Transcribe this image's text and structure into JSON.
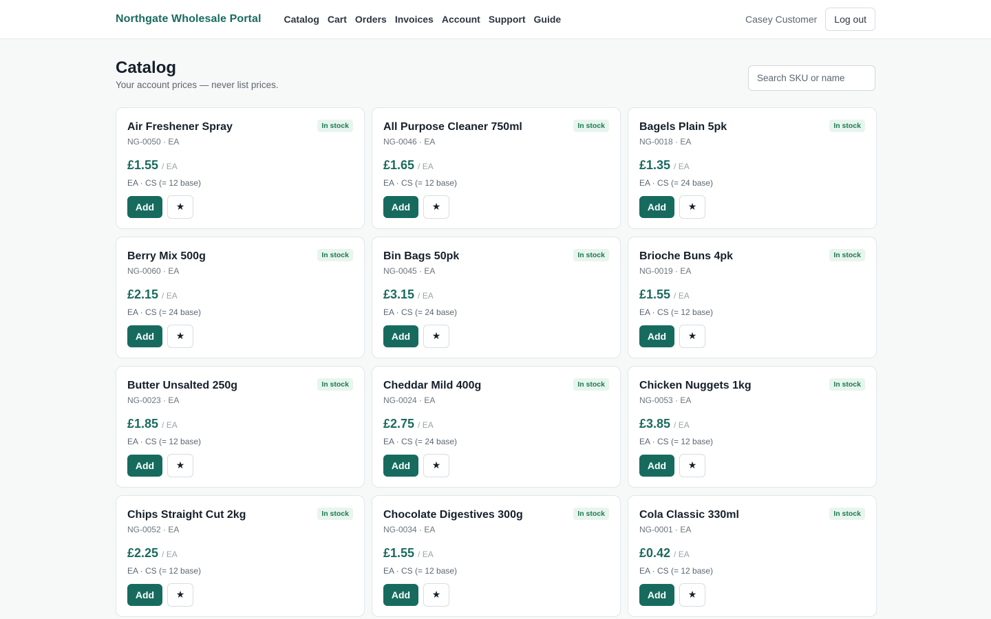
{
  "header": {
    "brand": "Northgate Wholesale Portal",
    "nav": [
      "Catalog",
      "Cart",
      "Orders",
      "Invoices",
      "Account",
      "Support",
      "Guide"
    ],
    "user_name": "Casey Customer",
    "logout_label": "Log out"
  },
  "page": {
    "title": "Catalog",
    "subtitle": "Your account prices — never list prices.",
    "search_placeholder": "Search SKU or name"
  },
  "products": [
    {
      "name": "Air Freshener Spray",
      "meta": "NG-0050 · EA",
      "price": "£1.55",
      "per_unit": "/ EA",
      "units": "EA · CS (= 12 base)",
      "badge": "In stock",
      "add_label": "Add",
      "fav_icon": "★"
    },
    {
      "name": "All Purpose Cleaner 750ml",
      "meta": "NG-0046 · EA",
      "price": "£1.65",
      "per_unit": "/ EA",
      "units": "EA · CS (= 12 base)",
      "badge": "In stock",
      "add_label": "Add",
      "fav_icon": "★"
    },
    {
      "name": "Bagels Plain 5pk",
      "meta": "NG-0018 · EA",
      "price": "£1.35",
      "per_unit": "/ EA",
      "units": "EA · CS (= 24 base)",
      "badge": "In stock",
      "add_label": "Add",
      "fav_icon": "★"
    },
    {
      "name": "Berry Mix 500g",
      "meta": "NG-0060 · EA",
      "price": "£2.15",
      "per_unit": "/ EA",
      "units": "EA · CS (= 24 base)",
      "badge": "In stock",
      "add_label": "Add",
      "fav_icon": "★"
    },
    {
      "name": "Bin Bags 50pk",
      "meta": "NG-0045 · EA",
      "price": "£3.15",
      "per_unit": "/ EA",
      "units": "EA · CS (= 24 base)",
      "badge": "In stock",
      "add_label": "Add",
      "fav_icon": "★"
    },
    {
      "name": "Brioche Buns 4pk",
      "meta": "NG-0019 · EA",
      "price": "£1.55",
      "per_unit": "/ EA",
      "units": "EA · CS (= 12 base)",
      "badge": "In stock",
      "add_label": "Add",
      "fav_icon": "★"
    },
    {
      "name": "Butter Unsalted 250g",
      "meta": "NG-0023 · EA",
      "price": "£1.85",
      "per_unit": "/ EA",
      "units": "EA · CS (= 12 base)",
      "badge": "In stock",
      "add_label": "Add",
      "fav_icon": "★"
    },
    {
      "name": "Cheddar Mild 400g",
      "meta": "NG-0024 · EA",
      "price": "£2.75",
      "per_unit": "/ EA",
      "units": "EA · CS (= 24 base)",
      "badge": "In stock",
      "add_label": "Add",
      "fav_icon": "★"
    },
    {
      "name": "Chicken Nuggets 1kg",
      "meta": "NG-0053 · EA",
      "price": "£3.85",
      "per_unit": "/ EA",
      "units": "EA · CS (= 12 base)",
      "badge": "In stock",
      "add_label": "Add",
      "fav_icon": "★"
    },
    {
      "name": "Chips Straight Cut 2kg",
      "meta": "NG-0052 · EA",
      "price": "£2.25",
      "per_unit": "/ EA",
      "units": "EA · CS (= 12 base)",
      "badge": "In stock",
      "add_label": "Add",
      "fav_icon": "★"
    },
    {
      "name": "Chocolate Digestives 300g",
      "meta": "NG-0034 · EA",
      "price": "£1.55",
      "per_unit": "/ EA",
      "units": "EA · CS (= 12 base)",
      "badge": "In stock",
      "add_label": "Add",
      "fav_icon": "★"
    },
    {
      "name": "Cola Classic 330ml",
      "meta": "NG-0001 · EA",
      "price": "£0.42",
      "per_unit": "/ EA",
      "units": "EA · CS (= 12 base)",
      "badge": "In stock",
      "add_label": "Add",
      "fav_icon": "★"
    }
  ],
  "colors": {
    "brand": "#1a6b5f",
    "add_button": "#166b5e",
    "badge_bg": "#e7f5ee",
    "badge_text": "#1c7a4e"
  }
}
